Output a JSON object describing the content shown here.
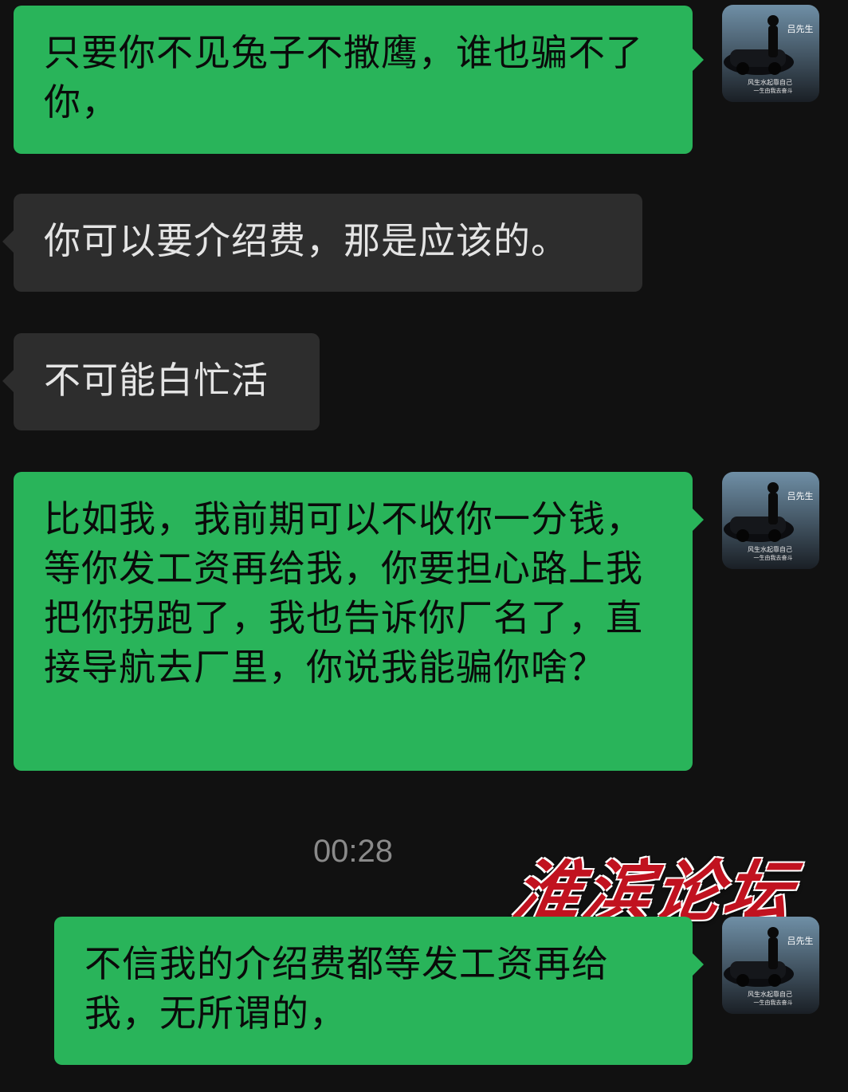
{
  "messages": [
    {
      "side": "sent",
      "text": "只要你不见兔子不撒鹰，谁也骗不了你，"
    },
    {
      "side": "received",
      "text": "你可以要介绍费，那是应该的。"
    },
    {
      "side": "received",
      "text": "不可能白忙活"
    },
    {
      "side": "sent",
      "text": "比如我，我前期可以不收你一分钱，等你发工资再给我，你要担心路上我把你拐跑了，我也告诉你厂名了，直接导航去厂里，你说我能骗你啥？"
    },
    {
      "side": "sent",
      "text": "不信我的介绍费都等发工资再给我，无所谓的，"
    }
  ],
  "timestamp": "00:28",
  "watermark": "淮滨论坛",
  "avatar": {
    "name_text": "吕先生",
    "caption_line1": "风生水起靠自己",
    "caption_line2": "一生由我去奋斗"
  },
  "colors": {
    "background": "#111111",
    "sent_bubble": "#29b45a",
    "received_bubble": "#2d2d2d",
    "watermark": "#c1121f"
  }
}
